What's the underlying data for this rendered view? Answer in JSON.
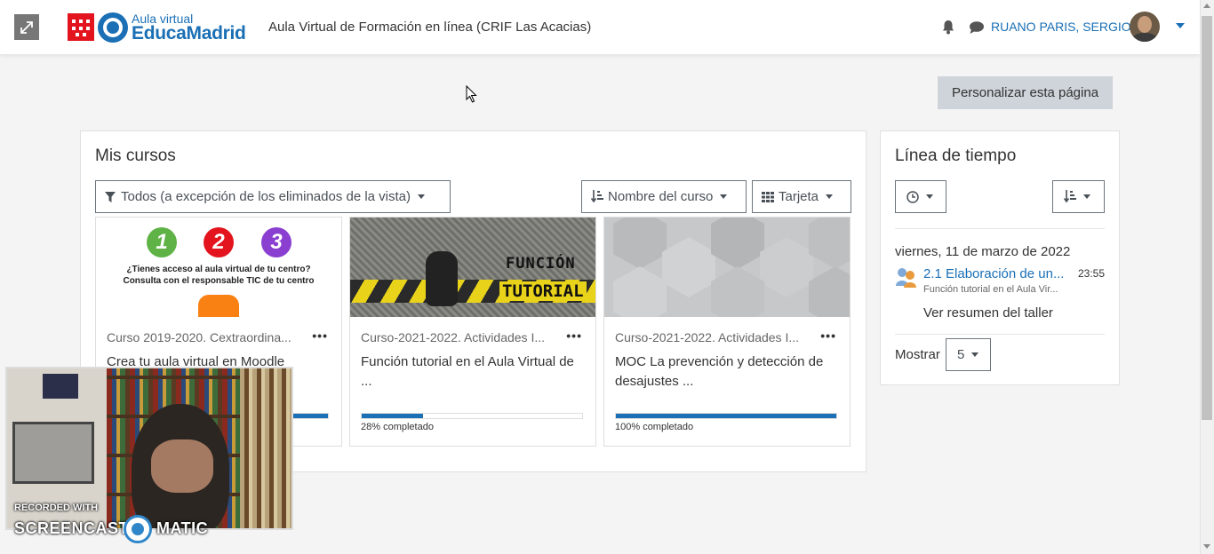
{
  "navbar": {
    "logo_top": "Aula virtual",
    "logo_main": "EducaMadrid",
    "site_title": "Aula Virtual de Formación en línea (CRIF Las Acacias)",
    "user_name": "RUANO PARIS, SERGIO"
  },
  "page": {
    "customize_label": "Personalizar esta página"
  },
  "courses": {
    "title": "Mis cursos",
    "filter_label": "Todos (a excepción de los eliminados de la vista)",
    "sort_label": "Nombre del curso",
    "view_label": "Tarjeta",
    "cards": [
      {
        "category": "Curso 2019-2020. Cextraordina...",
        "name": "Crea tu aula virtual en Moodle",
        "progress": 1.0,
        "image_text_1": "¿Tienes acceso al aula virtual de tu centro?",
        "image_text_2": "Consulta con el responsable TIC de tu centro",
        "image_nums": [
          "1",
          "2",
          "3"
        ]
      },
      {
        "category": "Curso-2021-2022. Actividades I...",
        "name": "Función tutorial en el Aula Virtual de ...",
        "progress": 0.28,
        "progress_label": "28% completado",
        "image_text_1": "FUNCIÓN",
        "image_text_2": "TUTORIAL"
      },
      {
        "category": "Curso-2021-2022. Actividades I...",
        "name": "MOC La prevención y detección de desajustes ...",
        "progress": 1.0,
        "progress_label": "100% completado"
      }
    ]
  },
  "timeline": {
    "title": "Línea de tiempo",
    "date": "viernes, 11 de marzo de 2022",
    "event_title": "2.1 Elaboración de un...",
    "event_time": "23:55",
    "event_sub": "Función tutorial en el Aula Vir...",
    "event_action": "Ver resumen del taller",
    "show_label": "Mostrar",
    "show_value": "5"
  },
  "watermark": {
    "line1": "RECORDED WITH",
    "line2a": "SCREENCAST",
    "line2b": "MATIC"
  },
  "colors": {
    "accent": "#1a6fb5",
    "brand_red": "#e3141e",
    "background": "#f4f4f4"
  }
}
